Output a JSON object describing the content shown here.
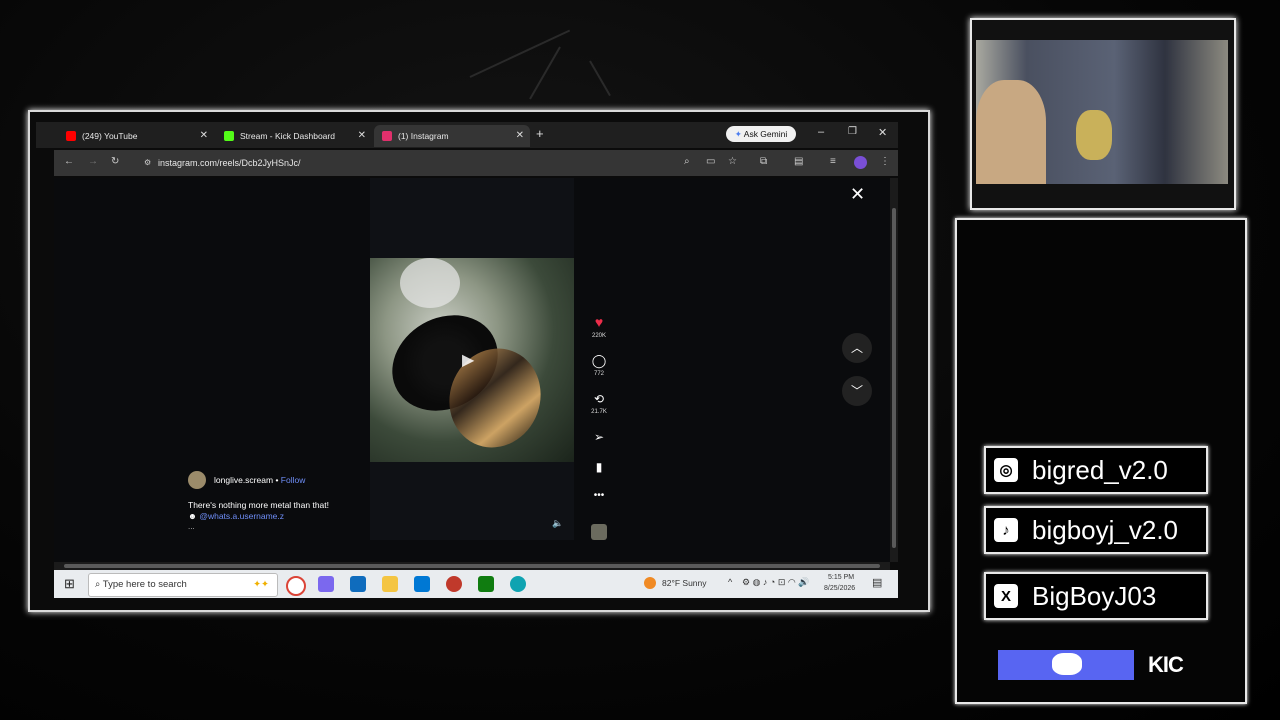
{
  "browser": {
    "tabs": [
      {
        "label": "(249) YouTube",
        "favicon_color": "#ff0000"
      },
      {
        "label": "Stream - Kick Dashboard",
        "favicon_color": "#53fc18"
      },
      {
        "label": "(1) Instagram",
        "favicon_color": "#e1306c"
      }
    ],
    "new_tab_label": "+",
    "gemini_label": "Ask Gemini",
    "url": "instagram.com/reels/Dcb2JyHSnJc/"
  },
  "reel": {
    "likes": "220K",
    "comments": "772",
    "reposts": "21.7K",
    "username": "longlive.scream",
    "follow_label": "Follow",
    "separator": "•",
    "caption": "There's nothing more metal than that!",
    "mention": "@whats.a.username.z",
    "more": "..."
  },
  "taskbar": {
    "search_placeholder": "Type here to search",
    "weather": "82°F  Sunny",
    "time": "5:15 PM",
    "date": "8/25/2026"
  },
  "socials": [
    {
      "handle": "bigred_v2.0",
      "icon": "instagram-icon"
    },
    {
      "handle": "bigboyj_v2.0",
      "icon": "tiktok-icon"
    },
    {
      "handle": "BigBoyJ03",
      "icon": "x-icon"
    }
  ],
  "kick_label": "KIC",
  "colors": {
    "accent_like": "#ed2d4a",
    "discord": "#5865f2",
    "follow_link": "#6f8ef7"
  }
}
